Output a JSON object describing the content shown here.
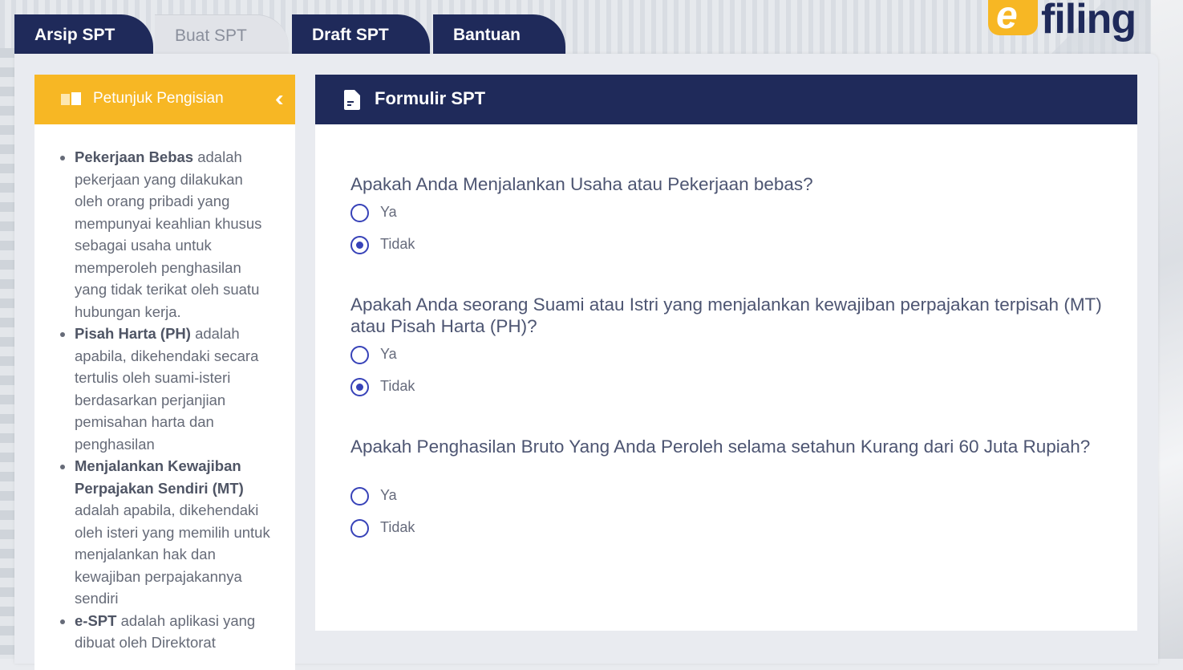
{
  "tabs": [
    {
      "label": "Arsip SPT",
      "active": true
    },
    {
      "label": "Buat SPT",
      "active": false
    },
    {
      "label": "Draft SPT",
      "active": true
    },
    {
      "label": "Bantuan",
      "active": true
    }
  ],
  "logo": {
    "mark": "e",
    "text": "filing"
  },
  "sidebar": {
    "title": "Petunjuk Pengisian",
    "collapse_icon": "double-chevron-left-icon",
    "items": [
      {
        "term": "Pekerjaan Bebas",
        "desc": " adalah pekerjaan yang dilakukan oleh orang pribadi yang mempunyai keahlian khusus sebagai usaha untuk memperoleh penghasilan yang tidak terikat oleh suatu hubungan kerja."
      },
      {
        "term": "Pisah Harta (PH)",
        "desc": " adalah apabila, dikehendaki secara tertulis oleh suami-isteri berdasarkan perjanjian pemisahan harta dan penghasilan"
      },
      {
        "term": "Menjalankan Kewajiban Perpajakan Sendiri (MT)",
        "desc": " adalah apabila, dikehendaki oleh isteri yang memilih untuk menjalankan hak dan kewajiban perpajakannya sendiri"
      },
      {
        "term": "e-SPT",
        "desc": " adalah aplikasi yang dibuat oleh Direktorat"
      }
    ]
  },
  "form": {
    "title": "Formulir SPT",
    "questions": [
      {
        "text": "Apakah Anda Menjalankan Usaha atau Pekerjaan bebas?",
        "options": [
          "Ya",
          "Tidak"
        ],
        "selected": "Tidak"
      },
      {
        "text": "Apakah Anda seorang Suami atau Istri yang menjalankan kewajiban perpajakan terpisah (MT) atau Pisah Harta (PH)?",
        "options": [
          "Ya",
          "Tidak"
        ],
        "selected": "Tidak"
      },
      {
        "text": "Apakah Penghasilan Bruto Yang Anda Peroleh selama setahun Kurang dari 60 Juta Rupiah?",
        "options": [
          "Ya",
          "Tidak"
        ],
        "selected": null
      }
    ]
  },
  "colors": {
    "navy": "#1f2a5a",
    "accent": "#f7b724",
    "radio": "#3742b8"
  }
}
